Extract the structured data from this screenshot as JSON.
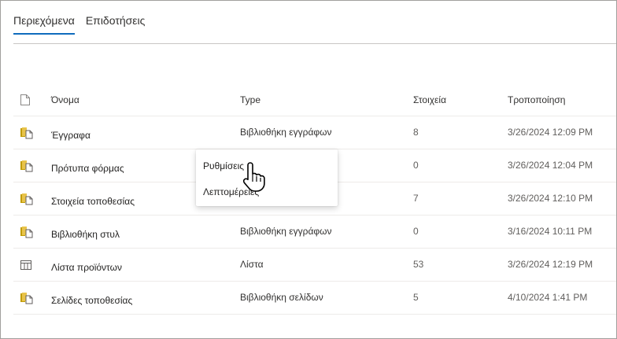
{
  "tabs": [
    {
      "label": "Περιεχόμενα",
      "active": true
    },
    {
      "label": "Επιδοτήσεις",
      "active": false
    }
  ],
  "columns": {
    "name": "Όνομα",
    "type": "Type",
    "items": "Στοιχεία",
    "modified": "Τροποποίηση"
  },
  "rows": [
    {
      "icon": "library-icon",
      "name": "Έγγραφα",
      "type": "Βιβλιοθήκη εγγράφων",
      "items": "8",
      "modified": "3/26/2024 12:09 PM"
    },
    {
      "icon": "library-icon",
      "name": "Πρότυπα φόρμας",
      "type": "",
      "items": "0",
      "modified": "3/26/2024 12:04 PM"
    },
    {
      "icon": "library-icon",
      "name": "Στοιχεία τοποθεσίας",
      "type": "",
      "items": "7",
      "modified": "3/26/2024 12:10 PM"
    },
    {
      "icon": "library-icon",
      "name": "Βιβλιοθήκη στυλ",
      "type": "Βιβλιοθήκη εγγράφων",
      "items": "0",
      "modified": "3/16/2024 10:11 PM"
    },
    {
      "icon": "list-icon",
      "name": "Λίστα προϊόντων",
      "type": "Λίστα",
      "items": "53",
      "modified": "3/26/2024 12:19 PM"
    },
    {
      "icon": "library-icon",
      "name": "Σελίδες τοποθεσίας",
      "type": "Βιβλιοθήκη σελίδων",
      "items": "5",
      "modified": "4/10/2024 1:41 PM"
    }
  ],
  "context_menu": {
    "items": [
      "Ρυθμίσεις",
      "Λεπτομέρειες"
    ]
  },
  "colors": {
    "accent": "#0f6cbd",
    "folder": "#c19c00"
  }
}
